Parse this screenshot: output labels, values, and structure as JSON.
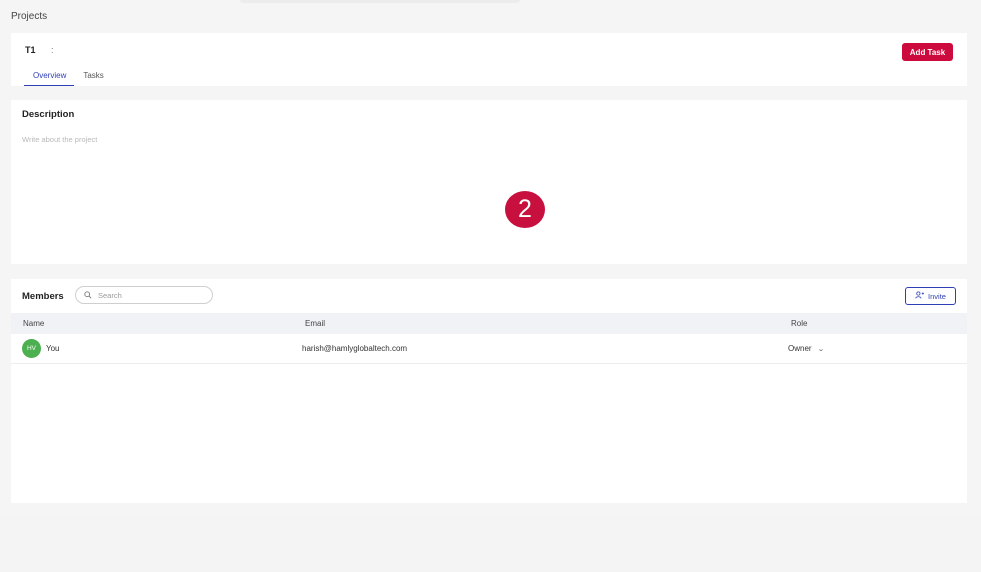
{
  "page": {
    "title": "Projects"
  },
  "project": {
    "name": "T1",
    "menu_glyph": ":",
    "add_task_label": "Add Task",
    "tabs": [
      {
        "label": "Overview",
        "active": true
      },
      {
        "label": "Tasks",
        "active": false
      }
    ]
  },
  "description": {
    "title": "Description",
    "placeholder": "Write about the project",
    "value": ""
  },
  "step_marker": "2",
  "members": {
    "title": "Members",
    "search_placeholder": "Search",
    "invite_label": "Invite",
    "columns": {
      "name": "Name",
      "email": "Email",
      "role": "Role"
    },
    "rows": [
      {
        "initials": "HV",
        "name": "You",
        "email": "harish@hamlyglobaltech.com",
        "role": "Owner",
        "avatar_color": "#4caf50"
      }
    ]
  },
  "colors": {
    "accent": "#2f3fb8",
    "primary_button": "#cc0a3e",
    "step_marker": "#c8103f"
  },
  "icons": {
    "search": "search-icon",
    "invite": "add-user-icon",
    "role_dropdown": "chevron-down-icon",
    "project_menu": "kebab-menu-icon"
  }
}
